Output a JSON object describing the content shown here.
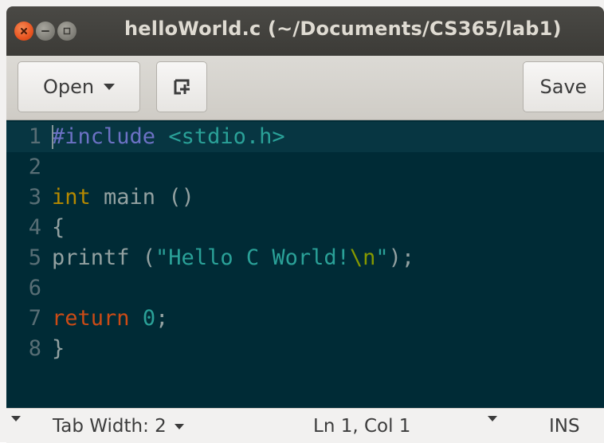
{
  "window": {
    "title": "helloWorld.c (~/Documents/CS365/lab1)"
  },
  "toolbar": {
    "open_label": "Open",
    "save_label": "Save",
    "new_tab_icon": "new-document-icon"
  },
  "editor": {
    "lines": [
      {
        "number": "1",
        "tokens": [
          {
            "t": "#include",
            "c": "preproc"
          },
          {
            "t": " ",
            "c": "plain"
          },
          {
            "t": "<stdio.h>",
            "c": "include"
          }
        ]
      },
      {
        "number": "2",
        "tokens": []
      },
      {
        "number": "3",
        "tokens": [
          {
            "t": "int",
            "c": "type"
          },
          {
            "t": " main ()",
            "c": "plain"
          }
        ]
      },
      {
        "number": "4",
        "tokens": [
          {
            "t": "{",
            "c": "plain"
          }
        ]
      },
      {
        "number": "5",
        "tokens": [
          {
            "t": "printf (",
            "c": "plain"
          },
          {
            "t": "\"Hello C World!",
            "c": "string"
          },
          {
            "t": "\\n",
            "c": "escape"
          },
          {
            "t": "\"",
            "c": "string"
          },
          {
            "t": ");",
            "c": "plain"
          }
        ]
      },
      {
        "number": "6",
        "tokens": []
      },
      {
        "number": "7",
        "tokens": [
          {
            "t": "return",
            "c": "keyword"
          },
          {
            "t": " ",
            "c": "plain"
          },
          {
            "t": "0",
            "c": "number"
          },
          {
            "t": ";",
            "c": "plain"
          }
        ]
      },
      {
        "number": "8",
        "tokens": [
          {
            "t": "}",
            "c": "plain"
          }
        ]
      }
    ],
    "colors": {
      "background": "#002b36",
      "current_line": "#073642"
    }
  },
  "statusbar": {
    "tab_width_label": "Tab Width: 2",
    "position_label": "Ln 1, Col 1",
    "mode_label": "INS"
  }
}
